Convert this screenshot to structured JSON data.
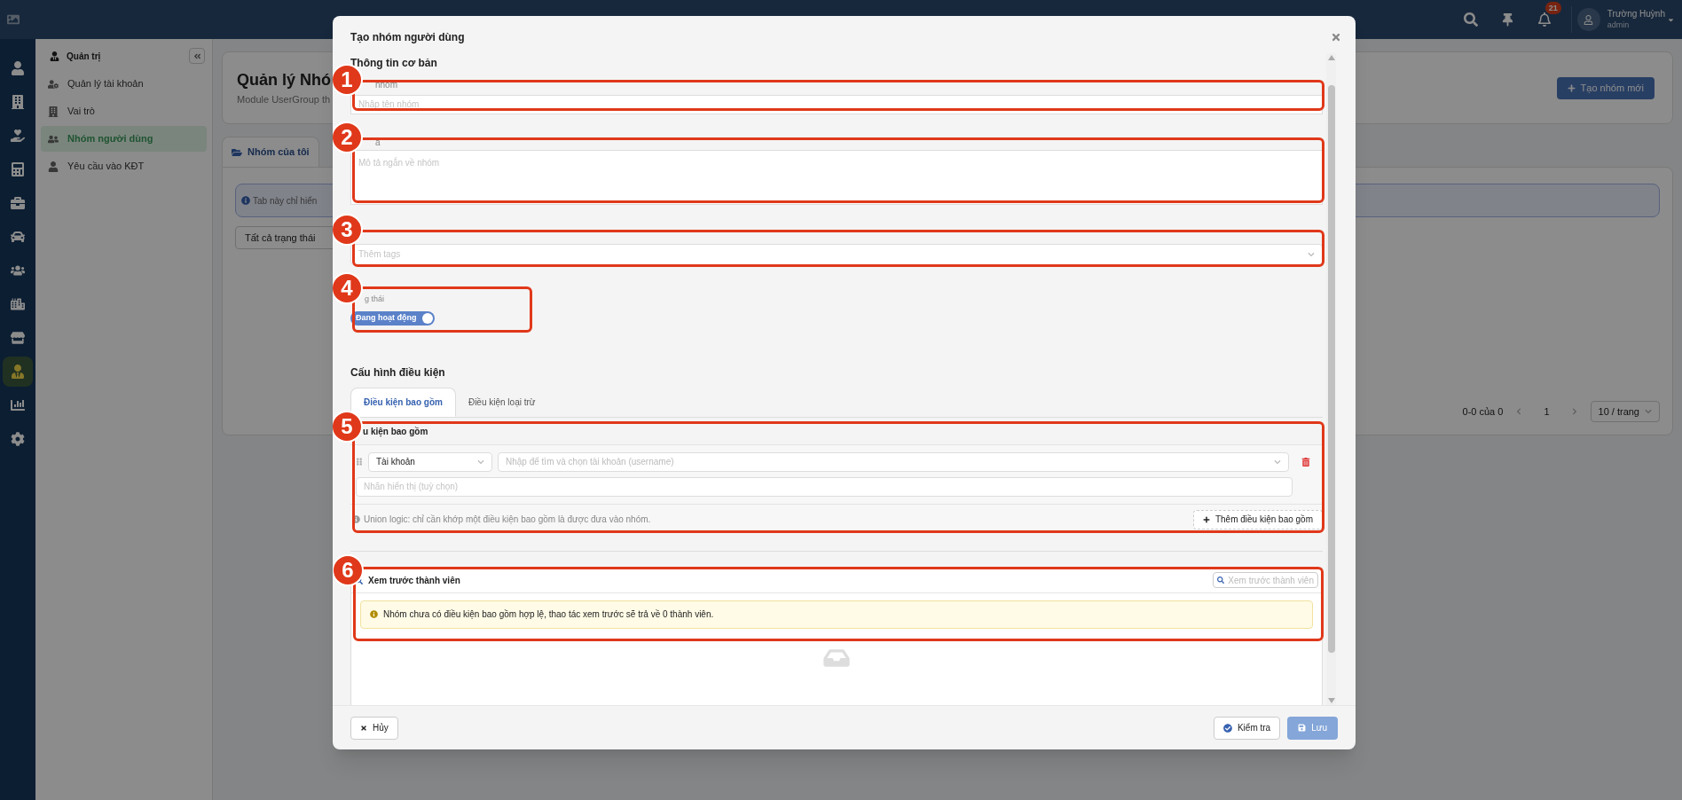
{
  "topbar": {
    "notification_count": "21",
    "user": {
      "name": "Trường Huỳnh",
      "role": "admin"
    }
  },
  "icon_rail": [
    {
      "selected": false
    },
    {
      "selected": false
    },
    {
      "selected": false
    },
    {
      "selected": false
    },
    {
      "selected": false
    },
    {
      "selected": false
    },
    {
      "selected": false
    },
    {
      "selected": false
    },
    {
      "selected": false
    },
    {
      "selected": true
    },
    {
      "selected": false
    },
    {
      "selected": false
    }
  ],
  "sidebar": {
    "title": "Quản trị",
    "items": [
      {
        "label": "Quản lý tài khoản",
        "selected": false
      },
      {
        "label": "Vai trò",
        "selected": false
      },
      {
        "label": "Nhóm người dùng",
        "selected": true
      },
      {
        "label": "Yêu cầu vào KĐT",
        "selected": false
      }
    ]
  },
  "page": {
    "title": "Quản lý Nhó",
    "subtitle": "Module UserGroup th",
    "create_button": "Tạo nhóm mới",
    "tabs": [
      {
        "label": "Nhóm của tôi",
        "selected": true
      }
    ],
    "info": "Tab này chỉ hiển",
    "status_filter": "Tất cả trạng thái",
    "pagination": {
      "range": "0-0 của 0",
      "page": "1",
      "page_size": "10 / trang"
    }
  },
  "modal": {
    "title": "Tạo nhóm người dùng",
    "basic_section": "Thông tin cơ bản",
    "name_field": {
      "label": "nhóm",
      "placeholder": "Nhập tên nhóm",
      "callout": "1"
    },
    "description_field": {
      "label": "ả",
      "placeholder": "Mô tả ngắn về nhóm",
      "callout": "2"
    },
    "tags_field": {
      "placeholder": "Thêm tags",
      "callout": "3"
    },
    "status_field": {
      "label": "g thái",
      "toggle": {
        "label": "Đang hoạt động",
        "on": true
      },
      "callout": "4"
    },
    "conditions": {
      "title": "Cấu hình điều kiện",
      "tabs": [
        {
          "label": "Điều kiện bao gồm",
          "selected": true
        },
        {
          "label": "Điều kiện loại trừ",
          "selected": false
        }
      ],
      "section": {
        "label": "u kiện bao gồm",
        "callout": "5",
        "rows": [
          {
            "field": "Tài khoản",
            "value_placeholder": "Nhập để tìm và chọn tài khoản (username)",
            "display_placeholder": "Nhãn hiển thị (tuỳ chọn)"
          }
        ],
        "note": "Union logic: chỉ cần khớp một điều kiện bao gồm là được đưa vào nhóm.",
        "add_button": "Thêm điều kiện bao gồm"
      }
    },
    "preview": {
      "title": "Xem trước thành viên",
      "search_placeholder": "Xem trước thành viên",
      "alert": "Nhóm chưa có điều kiện bao gồm hợp lệ, thao tác xem trước sẽ trả về 0 thành viên.",
      "callout": "6"
    },
    "footer": {
      "cancel": "Hủy",
      "check": "Kiểm tra",
      "save": {
        "label": "Lưu",
        "disabled": true
      }
    }
  }
}
